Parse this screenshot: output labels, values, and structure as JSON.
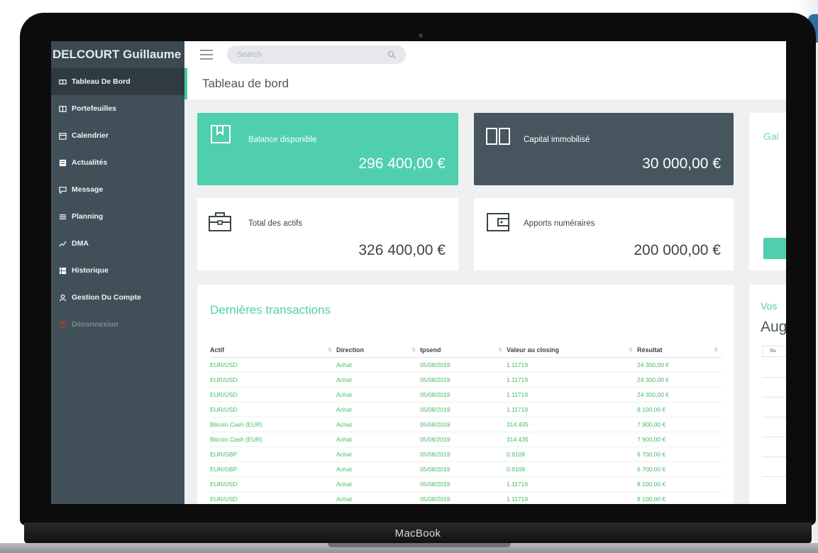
{
  "device_label": "MacBook",
  "sidebar": {
    "user_name": "DELCOURT Guillaume",
    "items": [
      {
        "label": "Tableau De Bord",
        "icon": "dashboard-icon",
        "active": true
      },
      {
        "label": "Portefeuilles",
        "icon": "wallet-icon"
      },
      {
        "label": "Calendrier",
        "icon": "calendar-icon"
      },
      {
        "label": "Actualités",
        "icon": "news-icon"
      },
      {
        "label": "Message",
        "icon": "message-icon"
      },
      {
        "label": "Planning",
        "icon": "planning-icon"
      },
      {
        "label": "DMA",
        "icon": "chart-icon"
      },
      {
        "label": "Historique",
        "icon": "history-icon"
      },
      {
        "label": "Gestion Du Compte",
        "icon": "user-icon"
      },
      {
        "label": "Déconnexion",
        "icon": "power-icon",
        "dim": true
      }
    ]
  },
  "search": {
    "placeholder": "Search"
  },
  "page": {
    "title": "Tableau de bord"
  },
  "cards": {
    "balance": {
      "title": "Balance disponible",
      "amount": "296 400,00 €",
      "color": "#4fcfae"
    },
    "capital": {
      "title": "Capital immobilisé",
      "amount": "30 000,00 €",
      "color": "#46555e"
    },
    "total": {
      "title": "Total des actifs",
      "amount": "326 400,00 €"
    },
    "apports": {
      "title": "Apports numéraires",
      "amount": "200 000,00 €"
    }
  },
  "side_panels": {
    "gains_title": "Gai",
    "vos_title": "Vos",
    "month": "Aug",
    "cal_col": "Su"
  },
  "transactions": {
    "title": "Dernières transactions",
    "columns": [
      "Actif",
      "Direction",
      "tpsend",
      "Valeur au closing",
      "Résultat"
    ],
    "rows": [
      [
        "EUR/USD",
        "Achat",
        "05/08/2019",
        "1.11719",
        "24 300,00 €"
      ],
      [
        "EUR/USD",
        "Achat",
        "05/08/2019",
        "1.11719",
        "24 300,00 €"
      ],
      [
        "EUR/USD",
        "Achat",
        "05/08/2019",
        "1.11719",
        "24 300,00 €"
      ],
      [
        "EUR/USD",
        "Achat",
        "05/08/2019",
        "1.11719",
        "8 100,00 €"
      ],
      [
        "Bitcoin Cash (EUR)",
        "Achat",
        "05/08/2019",
        "314.435",
        "7 900,00 €"
      ],
      [
        "Bitcoin Cash (EUR)",
        "Achat",
        "05/08/2019",
        "314.435",
        "7 900,00 €"
      ],
      [
        "EUR/GBP",
        "Achat",
        "05/08/2019",
        "0.9109",
        "6 700,00 €"
      ],
      [
        "EUR/GBP",
        "Achat",
        "05/08/2019",
        "0.9109",
        "6 700,00 €"
      ],
      [
        "EUR/USD",
        "Achat",
        "05/08/2019",
        "1.11719",
        "8 100,00 €"
      ],
      [
        "EUR/USD",
        "Achat",
        "05/08/2019",
        "1.11719",
        "8 100,00 €"
      ]
    ]
  },
  "colors": {
    "accent": "#4fcfae",
    "sidebar": "#415058",
    "positive": "#44b86a"
  }
}
